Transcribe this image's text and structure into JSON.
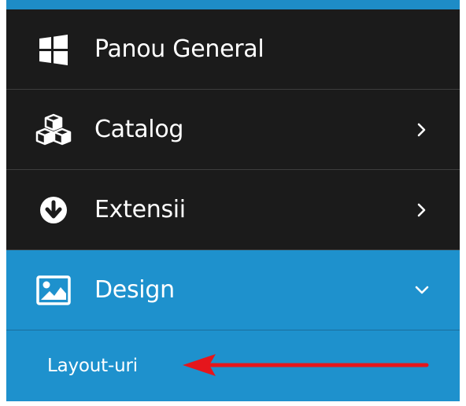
{
  "sidebar": {
    "items": [
      {
        "label": "Panou General",
        "icon": "windows-icon",
        "chevron": "none"
      },
      {
        "label": "Catalog",
        "icon": "cubes-icon",
        "chevron": "right"
      },
      {
        "label": "Extensii",
        "icon": "download-circle-icon",
        "chevron": "right"
      },
      {
        "label": "Design",
        "icon": "image-icon",
        "chevron": "down",
        "active": true
      }
    ],
    "submenu": {
      "items": [
        {
          "label": "Layout-uri"
        }
      ]
    }
  },
  "colors": {
    "sidebar_bg": "#1b1b1b",
    "active_bg": "#1e91cd",
    "annotation_arrow": "#e5161c"
  },
  "annotation": {
    "type": "arrow",
    "points_to": "Layout-uri"
  }
}
